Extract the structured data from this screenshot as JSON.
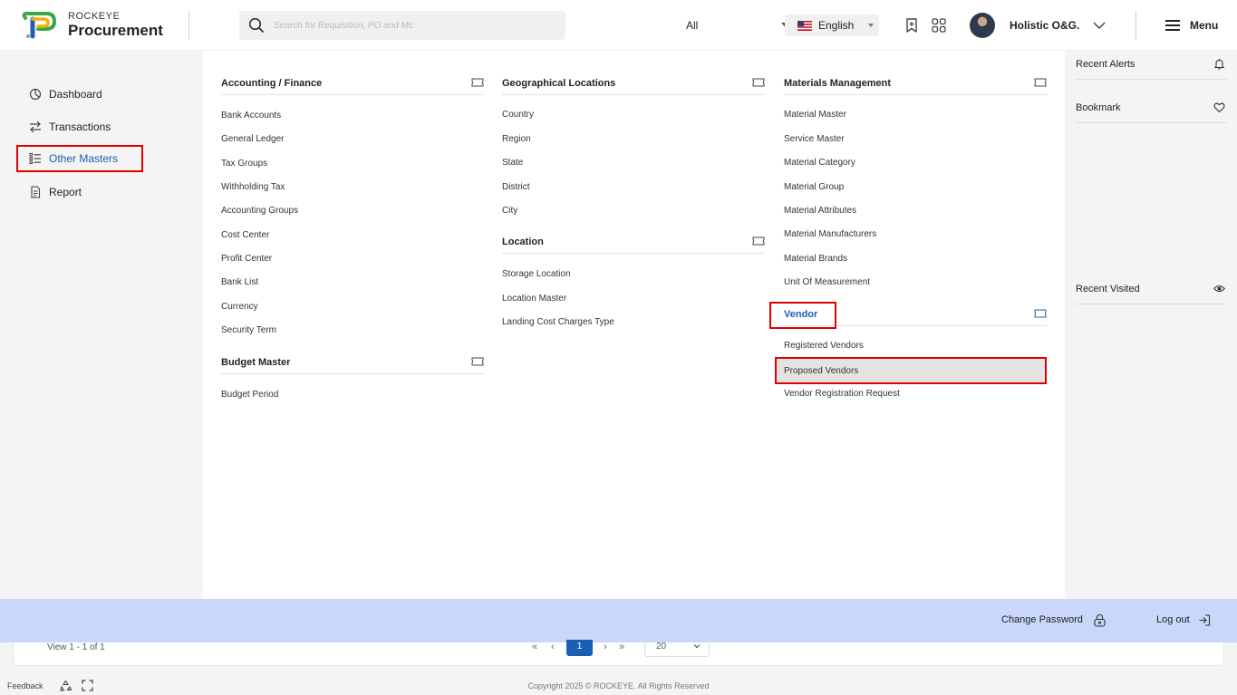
{
  "brand": {
    "top": "ROCKEYE",
    "name": "Procurement"
  },
  "search": {
    "placeholder": "Search for Requisition, PO and Mc",
    "scope": "All"
  },
  "language": {
    "label": "English"
  },
  "user": {
    "name": "Holistic O&G."
  },
  "menu": {
    "label": "Menu"
  },
  "sidebar": {
    "items": [
      {
        "label": "Dashboard",
        "icon": "dashboard-icon"
      },
      {
        "label": "Transactions",
        "icon": "transfer-icon"
      },
      {
        "label": "Other Masters",
        "icon": "list-icon",
        "active": true
      },
      {
        "label": "Report",
        "icon": "document-icon"
      }
    ]
  },
  "mega_menu": {
    "accounting": {
      "title": "Accounting / Finance",
      "links": [
        "Bank Accounts",
        "General Ledger",
        "Tax Groups",
        "Withholding Tax",
        "Accounting Groups",
        "Cost Center",
        "Profit Center",
        "Bank List",
        "Currency",
        "Security Term"
      ]
    },
    "budget": {
      "title": "Budget Master",
      "links": [
        "Budget Period"
      ]
    },
    "geo": {
      "title": "Geographical Locations",
      "links": [
        "Country",
        "Region",
        "State",
        "District",
        "City"
      ]
    },
    "location": {
      "title": "Location",
      "links": [
        "Storage Location",
        "Location Master",
        "Landing Cost Charges Type"
      ]
    },
    "materials": {
      "title": "Materials Management",
      "links": [
        "Material Master",
        "Service Master",
        "Material Category",
        "Material Group",
        "Material Attributes",
        "Material Manufacturers",
        "Material Brands",
        "Unit Of Measurement"
      ]
    },
    "vendor": {
      "title": "Vendor",
      "links": [
        "Registered Vendors",
        "Proposed Vendors",
        "Vendor Registration Request"
      ],
      "selected": "Proposed Vendors"
    }
  },
  "right_panel": {
    "recent_alerts": "Recent Alerts",
    "bookmark": "Bookmark",
    "recent_visited": "Recent Visited"
  },
  "bottom_bar": {
    "change_password": "Change Password",
    "logout": "Log out"
  },
  "pager": {
    "view_count": "View 1 - 1 of 1",
    "current_page": "1",
    "page_size": "20"
  },
  "footer": {
    "feedback": "Feedback",
    "copyright": "Copyright 2025 © ROCKEYE. All Rights Reserved"
  },
  "colors": {
    "accent": "#1a5fb4",
    "highlight": "#e00000",
    "bottom_bar": "#c9d7fb"
  }
}
